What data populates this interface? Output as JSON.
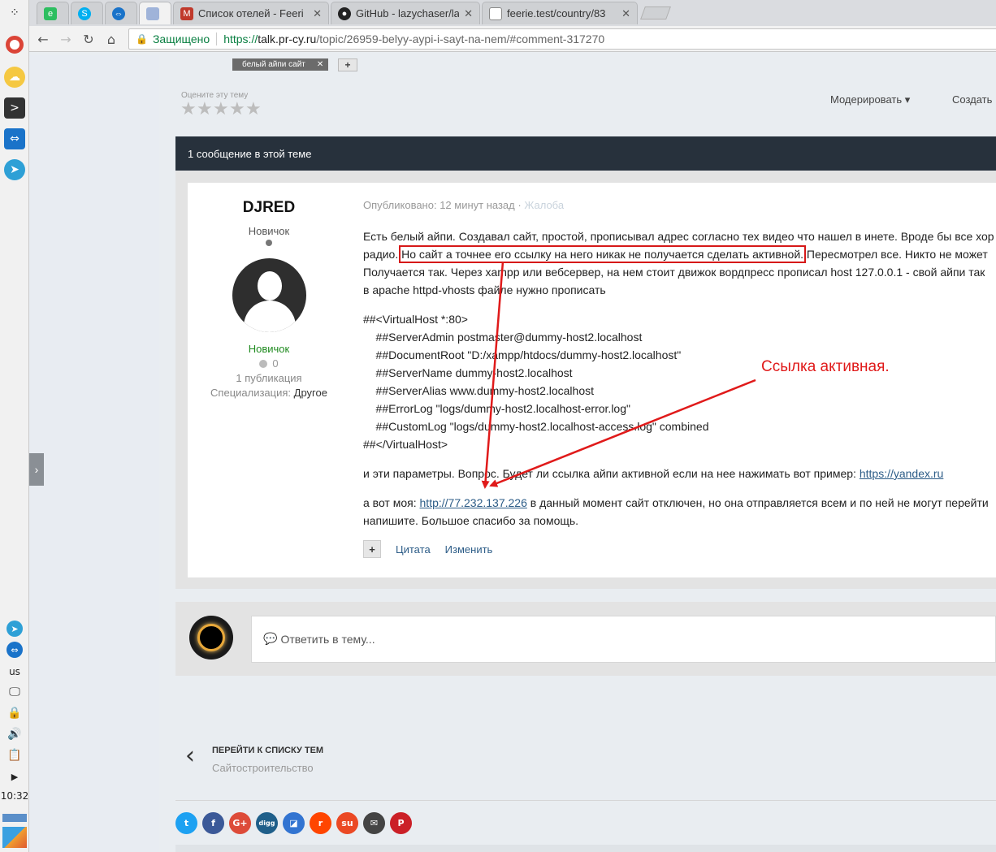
{
  "taskbar": {
    "language": "us",
    "clock": "10:32"
  },
  "browser": {
    "tabs": [
      {
        "label": "Список отелей - Feeri",
        "favicon_color": "#c0392b"
      },
      {
        "label": "GitHub - lazychaser/la",
        "favicon_color": "#222222"
      },
      {
        "label": "feerie.test/country/83",
        "favicon_color": "#777777"
      }
    ],
    "url": {
      "secure_label": "Защищено",
      "scheme": "https://",
      "host": "talk.pr-cy.ru",
      "path": "/topic/26959-belyy-aypi-i-sayt-na-nem/#comment-317270"
    }
  },
  "page": {
    "tag": "белый айпи сайт",
    "rate_label": "Оцените эту тему",
    "moderate": "Модерировать ▾",
    "create": "Создать",
    "thread_count": "1 сообщение в этой теме",
    "author": {
      "name": "DJRED",
      "rank": "Новичок",
      "group": "Новичок",
      "reputation": "0",
      "posts": "1 публикация",
      "spec_label": "Специализация:",
      "spec_value": "Другое"
    },
    "post": {
      "published": "Опубликовано: 12 минут назад",
      "report": "Жалоба",
      "p1_a": "Есть белый айпи. Создавал сайт, простой, прописывал адрес согласно тех видео что нашел в инете. Вроде бы все хор",
      "p1_b": "радио. ",
      "p1_highlight": "Но сайт а точнее его ссылку на него никак не получается сделать активной.",
      "p1_c": " Пересмотрел все. Никто не может",
      "p1_d": "Получается так. Через xampp или вебсервер, на нем стоит движок вордпресс прописал host 127.0.0.1 - свой айпи так",
      "p1_e": "в apache httpd-vhosts файле нужно прописать",
      "code": [
        "##<VirtualHost *:80>",
        "    ##ServerAdmin postmaster@dummy-host2.localhost",
        "    ##DocumentRoot \"D:/xampp/htdocs/dummy-host2.localhost\"",
        "    ##ServerName dummy-host2.localhost",
        "    ##ServerAlias www.dummy-host2.localhost",
        "    ##ErrorLog \"logs/dummy-host2.localhost-error.log\"",
        "    ##CustomLog \"logs/dummy-host2.localhost-access.log\" combined",
        "##</VirtualHost>"
      ],
      "p2_text": "и эти параметры. Вопрос. Будет ли ссылка айпи активной если на нее нажимать вот пример: ",
      "p2_link": "https://yandex.ru",
      "p3_pre": "а вот моя: ",
      "p3_link": "http://77.232.137.226",
      "p3_post": " в данный момент сайт отключен, но она отправляется всем и по ней не могут перейти",
      "p3_cont": "напишите. Большое спасибо за помощь.",
      "quote": "Цитата",
      "edit": "Изменить"
    },
    "annotation": "Ссылка активная.",
    "reply_placeholder": "Ответить в тему...",
    "pager": {
      "title": "ПЕРЕЙТИ К СПИСКУ ТЕМ",
      "subtitle": "Сайтостроительство"
    },
    "share": [
      {
        "name": "twitter",
        "color": "#1da1f2",
        "glyph": "t"
      },
      {
        "name": "facebook",
        "color": "#3b5998",
        "glyph": "f"
      },
      {
        "name": "google-plus",
        "color": "#dd4b39",
        "glyph": "G+"
      },
      {
        "name": "digg",
        "color": "#1f5f8a",
        "glyph": "digg"
      },
      {
        "name": "delicious",
        "color": "#3274d1",
        "glyph": "◪"
      },
      {
        "name": "reddit",
        "color": "#ff4500",
        "glyph": "r"
      },
      {
        "name": "stumbleupon",
        "color": "#eb4924",
        "glyph": "su"
      },
      {
        "name": "email",
        "color": "#444444",
        "glyph": "✉"
      },
      {
        "name": "pinterest",
        "color": "#cb2027",
        "glyph": "P"
      }
    ]
  }
}
